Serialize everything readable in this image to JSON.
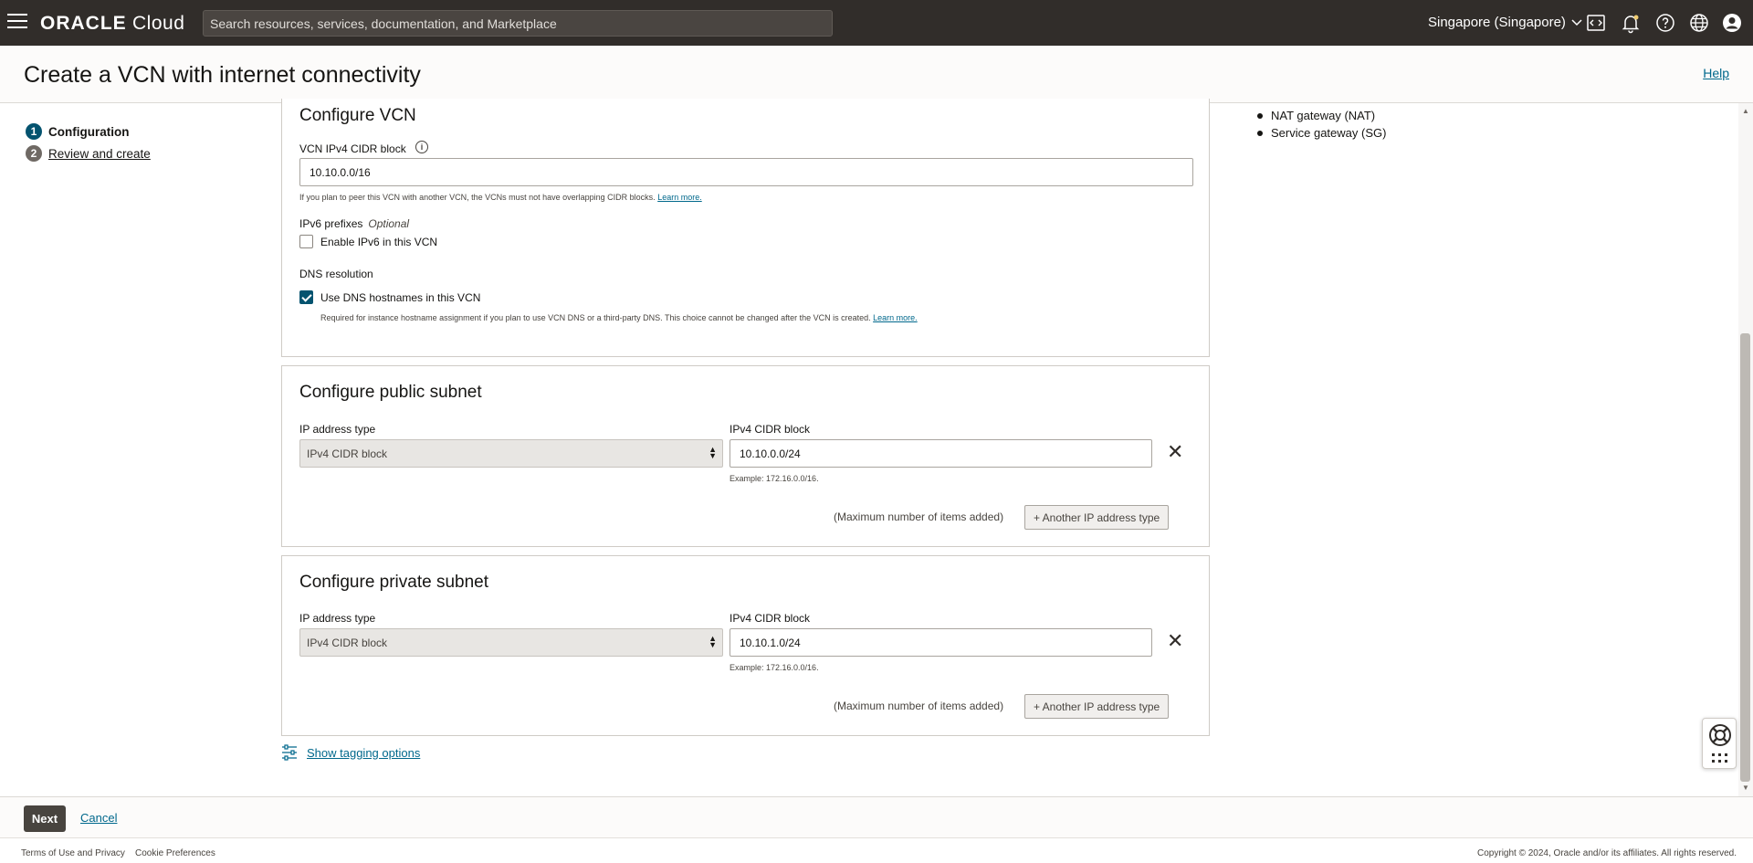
{
  "topbar": {
    "brand_bold": "ORACLE",
    "brand_light": "Cloud",
    "search_placeholder": "Search resources, services, documentation, and Marketplace",
    "region": "Singapore (Singapore)"
  },
  "page": {
    "title": "Create a VCN with internet connectivity",
    "help": "Help"
  },
  "steps": [
    {
      "num": "1",
      "label": "Configuration"
    },
    {
      "num": "2",
      "label": "Review and create"
    }
  ],
  "vcn": {
    "title": "Configure VCN",
    "cidr_label": "VCN IPv4 CIDR block",
    "cidr_value": "10.10.0.0/16",
    "cidr_help": "If you plan to peer this VCN with another VCN, the VCNs must not have overlapping CIDR blocks.",
    "learn_more": "Learn more.",
    "ipv6_label": "IPv6 prefixes",
    "ipv6_optional": "Optional",
    "ipv6_checkbox": "Enable IPv6 in this VCN",
    "dns_label": "DNS resolution",
    "dns_checkbox": "Use DNS hostnames in this VCN",
    "dns_help": "Required for instance hostname assignment if you plan to use VCN DNS or a third-party DNS. This choice cannot be changed after the VCN is created."
  },
  "public_subnet": {
    "title": "Configure public subnet",
    "ip_type_label": "IP address type",
    "ip_type_value": "IPv4 CIDR block",
    "cidr_label": "IPv4 CIDR block",
    "cidr_value": "10.10.0.0/24",
    "example": "Example: 172.16.0.0/16.",
    "max_note": "(Maximum number of items added)",
    "add_button": "+ Another IP address type"
  },
  "private_subnet": {
    "title": "Configure private subnet",
    "ip_type_label": "IP address type",
    "ip_type_value": "IPv4 CIDR block",
    "cidr_label": "IPv4 CIDR block",
    "cidr_value": "10.10.1.0/24",
    "example": "Example: 172.16.0.0/16.",
    "max_note": "(Maximum number of items added)",
    "add_button": "+ Another IP address type"
  },
  "tagging": "Show tagging options",
  "right_list": [
    "NAT gateway (NAT)",
    "Service gateway (SG)"
  ],
  "actions": {
    "next": "Next",
    "cancel": "Cancel"
  },
  "footer": {
    "terms": "Terms of Use and Privacy",
    "cookies": "Cookie Preferences",
    "copyright": "Copyright © 2024, Oracle and/or its affiliates. All rights reserved."
  }
}
